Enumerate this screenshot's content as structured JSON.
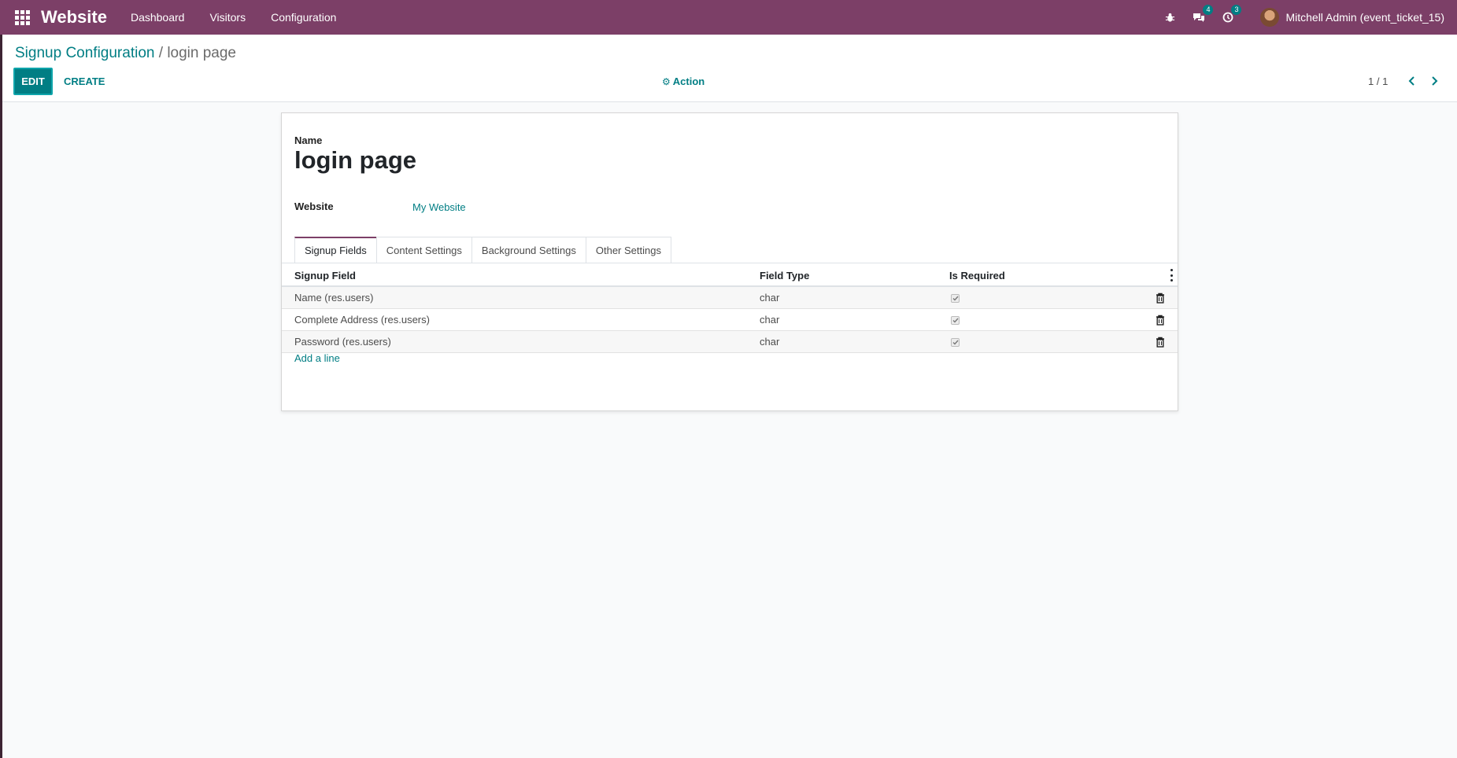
{
  "navbar": {
    "brand": "Website",
    "menu": [
      "Dashboard",
      "Visitors",
      "Configuration"
    ],
    "messages_count": "4",
    "activities_count": "3",
    "user_name": "Mitchell Admin (event_ticket_15)"
  },
  "breadcrumb": {
    "parent": "Signup Configuration",
    "separator": "/",
    "current": "login page"
  },
  "toolbar": {
    "edit_label": "EDIT",
    "create_label": "CREATE",
    "action_label": "Action",
    "pager": "1 / 1"
  },
  "form": {
    "name_label": "Name",
    "name_value": "login page",
    "website_label": "Website",
    "website_value": "My Website",
    "tabs": [
      "Signup Fields",
      "Content Settings",
      "Background Settings",
      "Other Settings"
    ],
    "table": {
      "headers": [
        "Signup Field",
        "Field Type",
        "Is Required"
      ],
      "rows": [
        {
          "field": "Name (res.users)",
          "type": "char",
          "required": true
        },
        {
          "field": "Complete Address (res.users)",
          "type": "char",
          "required": true
        },
        {
          "field": "Password (res.users)",
          "type": "char",
          "required": true
        }
      ]
    },
    "add_line_label": "Add a line"
  },
  "colors": {
    "navbar": "#7c3f67",
    "accent": "#017e84"
  }
}
